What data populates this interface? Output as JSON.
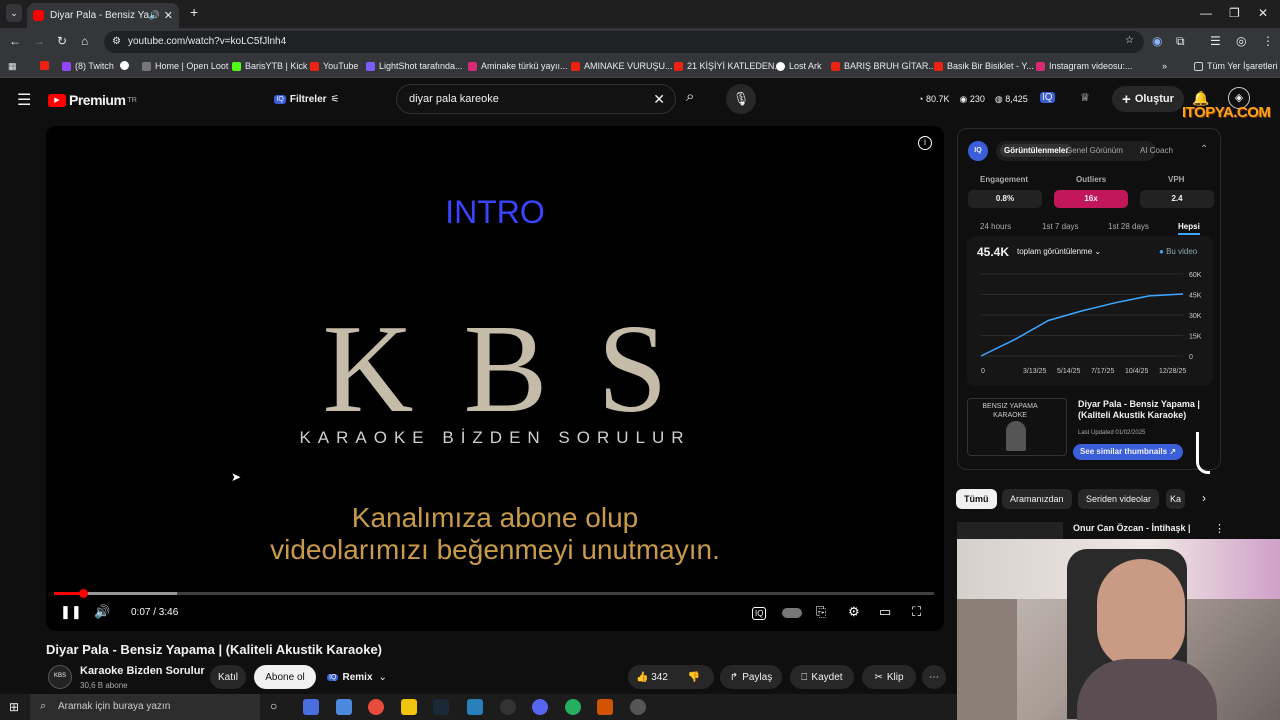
{
  "browser": {
    "tab_title": "Diyar Pala - Bensiz Yapama",
    "url": "youtube.com/watch?v=koLC5fJlnh4",
    "bookmarks": [
      "(8) Twitch",
      "Home | Open Loot",
      "BarisYTB | Kick",
      "YouTube",
      "LightShot tarafında...",
      "Aminake türkü yayıı...",
      "AMINAKE VURUŞU...",
      "21 KİŞİYİ KATLEDEN...",
      "Lost Ark",
      "BARIŞ BRUH GİTAR...",
      "Basik Bir Bisiklet - Y...",
      "Instagram videosu:..."
    ],
    "all_bookmarks": "Tüm Yer İşaretleri"
  },
  "yt": {
    "logo": "Premium",
    "logo_sup": "TR",
    "filters": "Filtreler",
    "search_value": "diyar pala kareoke",
    "stats": [
      "80.7K",
      "230",
      "8,425"
    ],
    "create": "Oluştur"
  },
  "video": {
    "intro": "NTRO",
    "intro_bar": "I",
    "kbs": "KBS",
    "kbs_sub": "KARAOKE BİZDEN SORULUR",
    "promo1": "Kanalımıza abone olup",
    "promo2": "videolarımızı beğenmeyi unutmayın.",
    "time": "0:07 / 3:46",
    "progress": 0.033,
    "buffered": 0.14,
    "title": "Diyar Pala - Bensiz Yapama | (Kaliteli Akustik Karaoke)"
  },
  "channel": {
    "name": "Karaoke Bizden Sorulur",
    "subs": "30,6 B abone",
    "join": "Katıl",
    "subscribe": "Abone ol",
    "remix": "Remix",
    "likes": "342",
    "share": "Paylaş",
    "save": "Kaydet",
    "clip": "Klip"
  },
  "vidiq": {
    "tabs": [
      "Görüntülenmeler",
      "Genel Görünüm",
      "AI Coach"
    ],
    "metrics": [
      {
        "label": "Engagement",
        "value": "0.8%"
      },
      {
        "label": "Outliers",
        "value": "16x"
      },
      {
        "label": "VPH",
        "value": "2.4"
      }
    ],
    "ranges": [
      "24 hours",
      "1st 7 days",
      "1st 28 days",
      "Hepsi"
    ],
    "total": "45.4K",
    "metric_select": "toplam görüntülenme",
    "legend": "Bu video",
    "yticks": [
      "60K",
      "45K",
      "30K",
      "15K",
      "0"
    ],
    "xticks": [
      "0",
      "3/13/25",
      "5/14/25",
      "7/17/25",
      "10/4/25",
      "12/28/25"
    ],
    "thumb_title": "Diyar Pala - Bensiz Yapama | (Kaliteli Akustik Karaoke)",
    "thumb_caption": "BENSIZ YAPAMA KARAOKE",
    "last_updated": "Last Updated 01/02/2025",
    "similar": "See similar thumbnails",
    "accent": "#c2185b"
  },
  "chips": [
    "Tümü",
    "Aramanızdan",
    "Seriden videolar",
    "Ka"
  ],
  "recommend": {
    "title": "Onur Can Özcan - İntihaşk |"
  },
  "watermark": "ITOPYA.COM",
  "taskbar": {
    "search": "Aramak için buraya yazın"
  },
  "chart_data": {
    "type": "line",
    "x": [
      "0",
      "3/13/25",
      "5/14/25",
      "7/17/25",
      "10/4/25",
      "12/28/25"
    ],
    "series": [
      {
        "name": "Bu video",
        "values": [
          0,
          12000,
          26000,
          33000,
          39000,
          44000,
          45400
        ]
      }
    ],
    "ylim": [
      0,
      60000
    ]
  }
}
